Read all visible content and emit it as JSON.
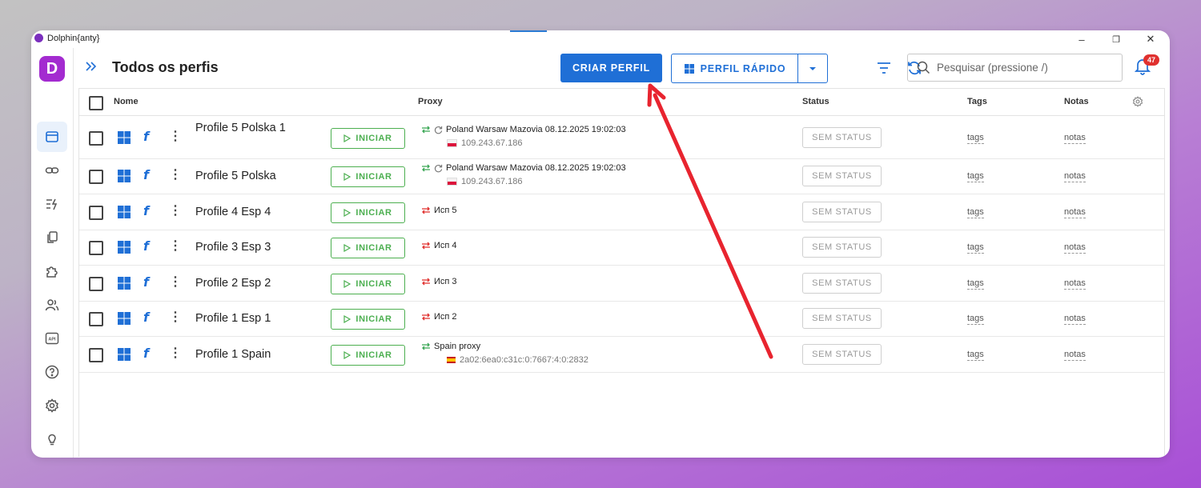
{
  "window": {
    "title": "Dolphin{anty}",
    "controls": {
      "minimize": "–",
      "maximize": "❐",
      "close": "✕"
    }
  },
  "app": {
    "logo_letter": "D"
  },
  "sidebar": {
    "items": [
      {
        "name": "profiles",
        "icon": "browser-window-icon",
        "active": true
      },
      {
        "name": "proxies",
        "icon": "link-icon"
      },
      {
        "name": "automation",
        "icon": "list-bolt-icon"
      },
      {
        "name": "copy",
        "icon": "copy-icon"
      },
      {
        "name": "extensions",
        "icon": "puzzle-icon"
      },
      {
        "name": "users",
        "icon": "users-icon"
      },
      {
        "name": "api",
        "icon": "api-icon",
        "label": "API"
      },
      {
        "name": "help",
        "icon": "help-icon"
      },
      {
        "name": "settings",
        "icon": "gear-icon"
      },
      {
        "name": "tips",
        "icon": "lightbulb-icon"
      }
    ]
  },
  "header": {
    "title": "Todos os perfis",
    "create_profile": "CRIAR PERFIL",
    "quick_profile": "PERFIL RÁPIDO",
    "search_placeholder": "Pesquisar (pressione /)",
    "notifications_count": "47"
  },
  "table": {
    "columns": {
      "name": "Nome",
      "proxy": "Proxy",
      "status": "Status",
      "tags": "Tags",
      "notes": "Notas"
    },
    "start_label": "INICIAR",
    "rows": [
      {
        "name": "Profile 5 Polska 1",
        "proxy_name": "Poland Warsaw Mazovia 08.12.2025 19:02:03",
        "proxy_ip": "109.243.67.186",
        "flag": "pl",
        "proxy_ok": true,
        "status": "SEM STATUS",
        "tags": "tags",
        "notes": "notas"
      },
      {
        "name": "Profile 5 Polska",
        "proxy_name": "Poland Warsaw Mazovia 08.12.2025 19:02:03",
        "proxy_ip": "109.243.67.186",
        "flag": "pl",
        "proxy_ok": true,
        "status": "SEM STATUS",
        "tags": "tags",
        "notes": "notas"
      },
      {
        "name": "Profile 4 Esp 4",
        "proxy_name": "Исп 5",
        "proxy_ip": "",
        "flag": "",
        "proxy_ok": false,
        "status": "SEM STATUS",
        "tags": "tags",
        "notes": "notas"
      },
      {
        "name": "Profile 3 Esp 3",
        "proxy_name": "Исп 4",
        "proxy_ip": "",
        "flag": "",
        "proxy_ok": false,
        "status": "SEM STATUS",
        "tags": "tags",
        "notes": "notas"
      },
      {
        "name": "Profile 2 Esp 2",
        "proxy_name": "Исп 3",
        "proxy_ip": "",
        "flag": "",
        "proxy_ok": false,
        "status": "SEM STATUS",
        "tags": "tags",
        "notes": "notas"
      },
      {
        "name": "Profile 1 Esp 1",
        "proxy_name": "Исп 2",
        "proxy_ip": "",
        "flag": "",
        "proxy_ok": false,
        "status": "SEM STATUS",
        "tags": "tags",
        "notes": "notas"
      },
      {
        "name": "Profile 1 Spain",
        "proxy_name": "Spain proxy",
        "proxy_ip": "2a02:6ea0:c31c:0:7667:4:0:2832",
        "flag": "es",
        "proxy_ok": true,
        "status": "SEM STATUS",
        "tags": "tags",
        "notes": "notas"
      }
    ]
  },
  "colors": {
    "primary": "#1f6fd6",
    "start_green": "#4caf50",
    "proxy_ok": "#3aa655",
    "proxy_err": "#e0312f",
    "annotation_arrow": "#e8242f",
    "brand": "#a32bd0"
  }
}
